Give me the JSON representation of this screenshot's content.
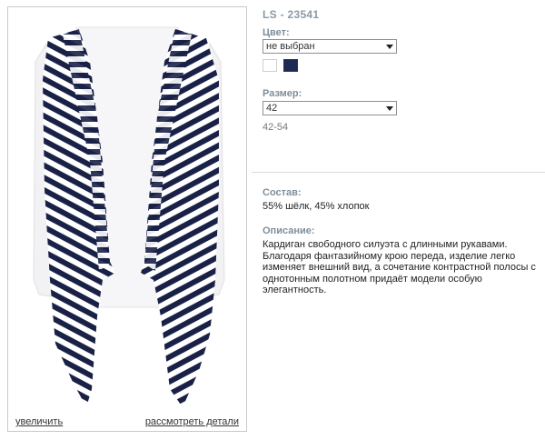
{
  "photo": {
    "zoom_label": "увеличить",
    "details_label": "рассмотреть детали",
    "stripe_dark": "#1a2147",
    "stripe_light": "#ffffff"
  },
  "product": {
    "sku": "LS - 23541"
  },
  "color": {
    "label": "Цвет:",
    "selected": "не выбран",
    "swatches": [
      "#ffffff",
      "#1f2a52"
    ]
  },
  "size": {
    "label": "Размер:",
    "selected": "42",
    "range": "42-54"
  },
  "composition": {
    "label": "Состав:",
    "value": "55% шёлк, 45% хлопок"
  },
  "description": {
    "label": "Описание:",
    "lines": [
      "Кардиган свободного силуэта с длинными рукавами.",
      "Благодаря фантазийному крою переда, изделие легко",
      "изменяет внешний вид, а сочетание контрастной полосы с",
      "однотонным полотном придаёт модели особую элегантность."
    ]
  }
}
